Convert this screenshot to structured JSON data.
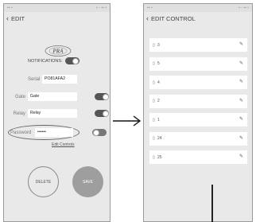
{
  "left_screen": {
    "title": "EDIT",
    "logo_text": "PRA",
    "notifications_label": "NOTIFICATIONS:",
    "notifications_on": true,
    "serial_label": "Serial",
    "serial_value": "PO81AFA2",
    "gate_label": "Gate",
    "gate_value": "Gate",
    "gate_on": true,
    "relay_label": "Relay",
    "relay_value": "Relay",
    "relay_on": true,
    "password_label": "Password",
    "password_value": "••••••",
    "password_on": false,
    "edit_controls_link": "Edit Controls",
    "delete_label": "DELETE",
    "save_label": "SAVE"
  },
  "right_screen": {
    "title": "EDIT CONTROL",
    "items": [
      {
        "label": "3"
      },
      {
        "label": "5"
      },
      {
        "label": "4"
      },
      {
        "label": "2"
      },
      {
        "label": "1"
      },
      {
        "label": "24"
      },
      {
        "label": "25"
      }
    ]
  },
  "icons": {
    "back": "chevron-left-icon",
    "edit": "pencil-icon",
    "control": "remote-icon"
  }
}
